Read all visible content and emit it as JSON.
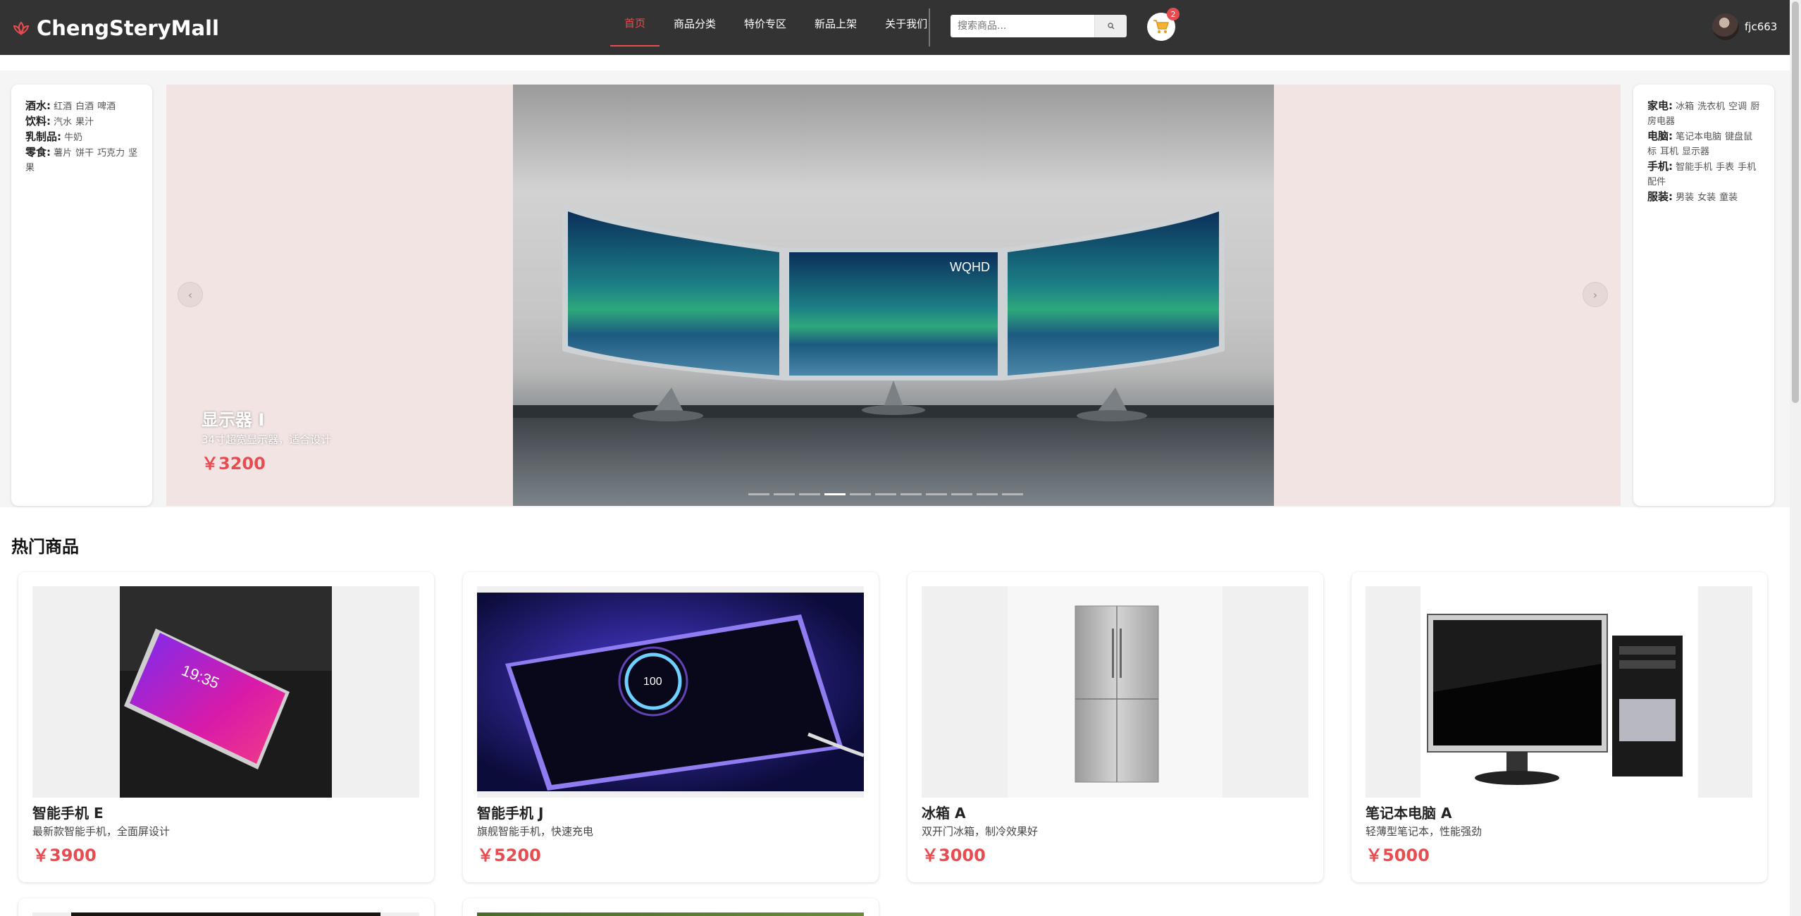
{
  "header": {
    "brand": "ChengSteryMall",
    "nav": [
      {
        "label": "首页",
        "active": true
      },
      {
        "label": "商品分类",
        "active": false
      },
      {
        "label": "特价专区",
        "active": false
      },
      {
        "label": "新品上架",
        "active": false
      },
      {
        "label": "关于我们",
        "active": false
      }
    ],
    "search_placeholder": "搜索商品...",
    "cart_count": "2",
    "username": "fjc663",
    "colors": {
      "header_bg": "#333333",
      "accent": "#e84c50"
    }
  },
  "categories_left": [
    {
      "name": "酒水:",
      "subs": [
        "红酒",
        "白酒",
        "啤酒"
      ]
    },
    {
      "name": "饮料:",
      "subs": [
        "汽水",
        "果汁"
      ]
    },
    {
      "name": "乳制品:",
      "subs": [
        "牛奶"
      ]
    },
    {
      "name": "零食:",
      "subs": [
        "薯片",
        "饼干",
        "巧克力",
        "坚果"
      ]
    }
  ],
  "categories_right": [
    {
      "name": "家电:",
      "subs": [
        "冰箱",
        "洗衣机",
        "空调",
        "厨房电器"
      ]
    },
    {
      "name": "电脑:",
      "subs": [
        "笔记本电脑",
        "键盘鼠标",
        "耳机",
        "显示器"
      ]
    },
    {
      "name": "手机:",
      "subs": [
        "智能手机",
        "手表",
        "手机配件"
      ]
    },
    {
      "name": "服装:",
      "subs": [
        "男装",
        "女装",
        "童装"
      ]
    }
  ],
  "carousel": {
    "title": "显示器 I",
    "desc": "34寸超宽显示器，适合设计",
    "price": "￥3200",
    "image_label": "WQHD",
    "slide_count": 11,
    "active_index": 3
  },
  "hot": {
    "title": "热门商品",
    "products": [
      {
        "name": "智能手机 E",
        "desc": "最新款智能手机，全面屏设计",
        "price": "￥3900",
        "image": "phone-pink"
      },
      {
        "name": "智能手机 J",
        "desc": "旗舰智能手机，快速充电",
        "price": "￥5200",
        "image": "phone-charging"
      },
      {
        "name": "冰箱 A",
        "desc": "双开门冰箱，制冷效果好",
        "price": "￥3000",
        "image": "fridge"
      },
      {
        "name": "笔记本电脑 A",
        "desc": "轻薄型笔记本，性能强劲",
        "price": "￥5000",
        "image": "desktop-pc"
      }
    ]
  }
}
